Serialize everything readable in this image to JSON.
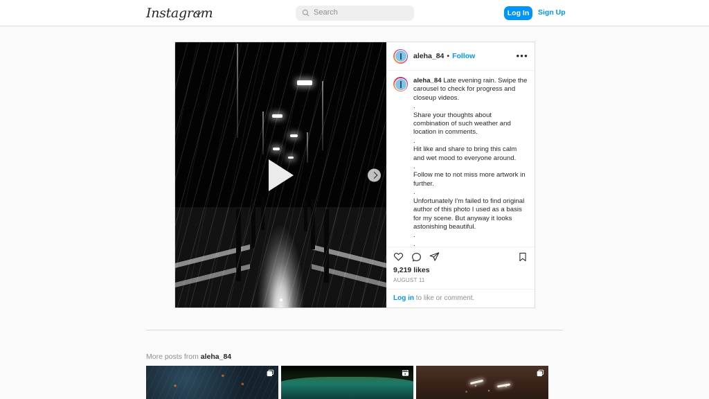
{
  "nav": {
    "logo": "Instagram",
    "logo_caret_icon": "chevron-down-icon",
    "search_icon": "search-icon",
    "search_placeholder": "Search",
    "search_value": "",
    "login_label": "Log In",
    "signup_label": "Sign Up",
    "accent_color": "#0095f6"
  },
  "post": {
    "username": "aleha_84",
    "separator": "•",
    "follow_label": "Follow",
    "more_options_icon": "ellipsis-icon",
    "avatar_icon": "user-avatar",
    "media": {
      "type": "video-carousel",
      "play_icon": "play-icon",
      "next_icon": "chevron-right-icon",
      "carousel_dots": 1,
      "alt": "Dark rainy night scene on a wooden boardwalk with street lamps and reflections"
    },
    "caption_author": "aleha_84",
    "caption": " Late evening rain. Swipe the carousel to check for progress and closeup videos.\n.\nShare your thoughts about combination of such weather and location in comments.\n.\nHit like and share to bring this calm and wet mood to everyone around.\n.\nFollow me to not miss more artwork in further.\n.\nUnfortunately I'm failed to find original author of this photo I used as a basis for my scene. But anyway it looks astonishing beautiful.\n.\n.",
    "actions": {
      "like_icon": "heart-icon",
      "comment_icon": "comment-icon",
      "share_icon": "share-icon",
      "save_icon": "bookmark-icon"
    },
    "likes": "9,219 likes",
    "date": "AUGUST 11",
    "login_prompt_link": "Log in",
    "login_prompt_text": " to like or comment."
  },
  "more_posts": {
    "heading_prefix": "More posts from ",
    "heading_user": "aleha_84",
    "thumbnails": [
      {
        "name": "thumbnail-1",
        "badge_icon": "carousel-icon",
        "alt": "Dark blue forest scene with orange lights"
      },
      {
        "name": "thumbnail-2",
        "badge_icon": "reel-icon",
        "alt": "Green hillside with waterfall at night"
      },
      {
        "name": "thumbnail-3",
        "badge_icon": "carousel-icon",
        "alt": "Brown sepia night scene with street lamps and snow"
      }
    ]
  }
}
